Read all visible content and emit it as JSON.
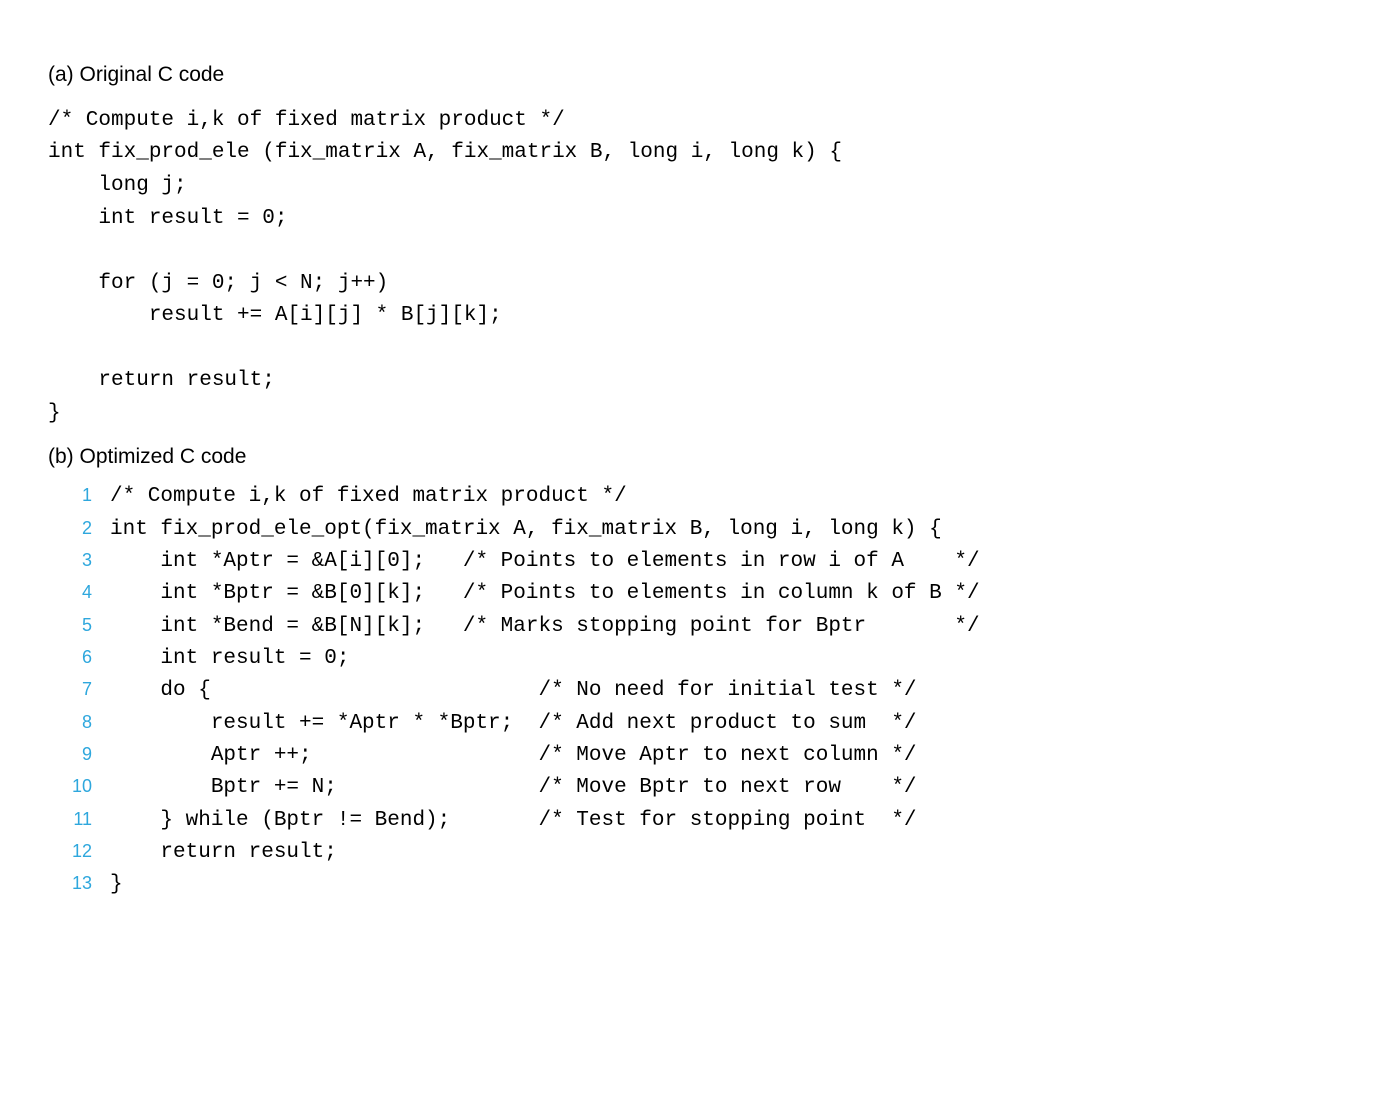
{
  "section_a": {
    "heading": "(a) Original C code",
    "code": "/* Compute i,k of fixed matrix product */\nint fix_prod_ele (fix_matrix A, fix_matrix B, long i, long k) {\n    long j;\n    int result = 0;\n\n    for (j = 0; j < N; j++)\n        result += A[i][j] * B[j][k];\n\n    return result;\n}"
  },
  "section_b": {
    "heading": "(b) Optimized C code",
    "lines": [
      {
        "n": "1",
        "code": "/* Compute i,k of fixed matrix product */"
      },
      {
        "n": "2",
        "code": "int fix_prod_ele_opt(fix_matrix A, fix_matrix B, long i, long k) {"
      },
      {
        "n": "3",
        "code": "    int *Aptr = &A[i][0];   /* Points to elements in row i of A    */"
      },
      {
        "n": "4",
        "code": "    int *Bptr = &B[0][k];   /* Points to elements in column k of B */"
      },
      {
        "n": "5",
        "code": "    int *Bend = &B[N][k];   /* Marks stopping point for Bptr       */"
      },
      {
        "n": "6",
        "code": "    int result = 0;"
      },
      {
        "n": "7",
        "code": "    do {                          /* No need for initial test */"
      },
      {
        "n": "8",
        "code": "        result += *Aptr * *Bptr;  /* Add next product to sum  */"
      },
      {
        "n": "9",
        "code": "        Aptr ++;                  /* Move Aptr to next column */"
      },
      {
        "n": "10",
        "code": "        Bptr += N;                /* Move Bptr to next row    */"
      },
      {
        "n": "11",
        "code": "    } while (Bptr != Bend);       /* Test for stopping point  */"
      },
      {
        "n": "12",
        "code": "    return result;"
      },
      {
        "n": "13",
        "code": "}"
      }
    ]
  }
}
